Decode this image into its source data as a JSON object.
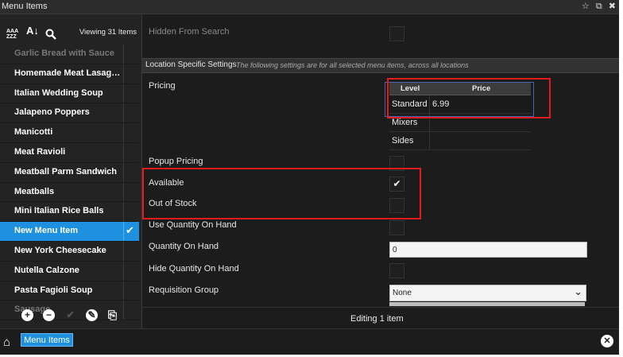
{
  "window": {
    "title": "Menu Items",
    "controls": [
      "☆",
      "⧉",
      "✖"
    ]
  },
  "toolbar": {
    "sort_az_icon": "sort-alpha-icon",
    "sort_icon": "sort-descending-icon",
    "search_icon": "search-icon",
    "viewing": "Viewing 31 Items"
  },
  "menu_items": [
    {
      "label": "Garlic Bread with Sauce",
      "state": "faded"
    },
    {
      "label": "Homemade Meat Lasag…",
      "state": "normal"
    },
    {
      "label": "Italian Wedding Soup",
      "state": "normal"
    },
    {
      "label": "Jalapeno Poppers",
      "state": "normal"
    },
    {
      "label": "Manicotti",
      "state": "normal"
    },
    {
      "label": "Meat Ravioli",
      "state": "normal"
    },
    {
      "label": "Meatball Parm Sandwich",
      "state": "normal"
    },
    {
      "label": "Meatballs",
      "state": "normal"
    },
    {
      "label": "Mini Italian Rice Balls",
      "state": "normal"
    },
    {
      "label": "New Menu Item",
      "state": "selected"
    },
    {
      "label": "New York Cheesecake",
      "state": "normal"
    },
    {
      "label": "Nutella Calzone",
      "state": "normal"
    },
    {
      "label": "Pasta Fagioli Soup",
      "state": "normal"
    },
    {
      "label": "Sausage",
      "state": "faded"
    }
  ],
  "actions": {
    "add": "+",
    "remove": "−",
    "confirm": "✔",
    "edit": "✎",
    "copy": "⎘"
  },
  "fields": {
    "hidden_from_search": "Hidden From Search",
    "section_title": "Location Specific Settings",
    "section_note": "The following settings are for all selected menu items, across all locations",
    "pricing": "Pricing",
    "popup_pricing": "Popup Pricing",
    "available": "Available",
    "out_of_stock": "Out of Stock",
    "use_qoh": "Use Quantity On Hand",
    "qoh": "Quantity On Hand",
    "hide_qoh": "Hide Quantity On Hand",
    "requisition_group": "Requisition Group"
  },
  "pricing_table": {
    "headers": [
      "Level",
      "Price"
    ],
    "rows": [
      {
        "level": "Standard",
        "price": "6.99"
      },
      {
        "level": "Mixers",
        "price": ""
      },
      {
        "level": "Sides",
        "price": ""
      }
    ]
  },
  "checkboxes": {
    "available": true,
    "out_of_stock": false
  },
  "qoh_value": "0",
  "requisition_value": "None",
  "status_text": "Editing 1 item",
  "taskbar": {
    "menu_items_label": "Menu Items"
  },
  "colors": {
    "accent": "#1e90e0",
    "highlight": "#e21b1b",
    "background": "#1c1c1c"
  }
}
